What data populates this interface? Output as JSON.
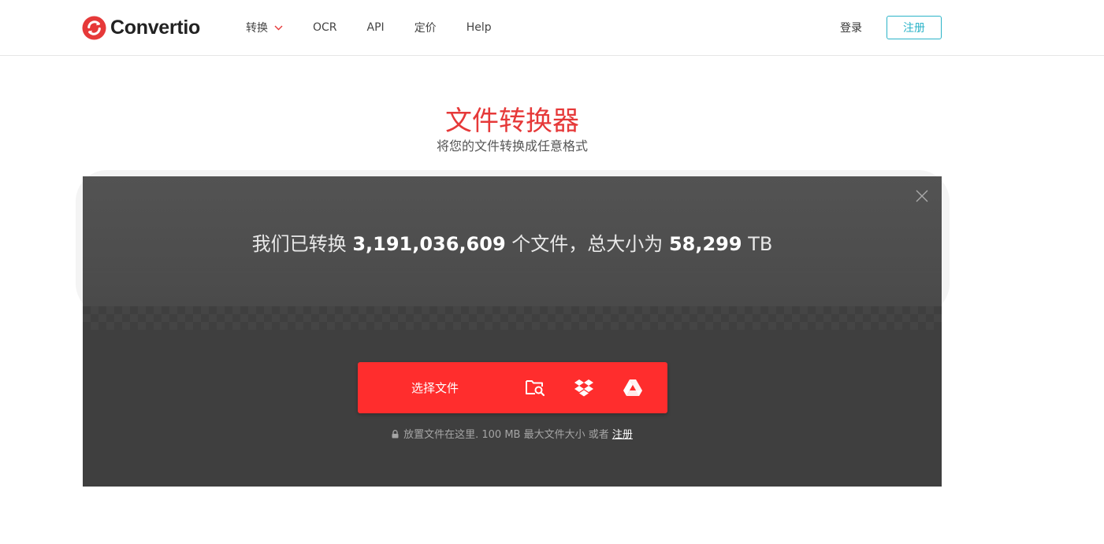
{
  "header": {
    "brand": "Convertio",
    "nav": [
      {
        "label": "转换",
        "has_dropdown": true
      },
      {
        "label": "OCR"
      },
      {
        "label": "API"
      },
      {
        "label": "定价"
      },
      {
        "label": "Help"
      }
    ],
    "login_label": "登录",
    "signup_label": "注册"
  },
  "hero": {
    "title": "文件转换器",
    "subtitle": "将您的文件转换成任意格式"
  },
  "stats": {
    "prefix": "我们已转换",
    "files_count": "3,191,036,609",
    "middle": "个文件，总大小为",
    "total_size": "58,299",
    "unit": "TB"
  },
  "upload": {
    "choose_label": "选择文件",
    "sources": [
      "computer-folder-icon",
      "dropbox-icon",
      "google-drive-icon"
    ],
    "note_text": "放置文件在这里. 100 MB 最大文件大小 或者",
    "note_link": "注册"
  },
  "colors": {
    "brand_red": "#e63939",
    "button_red": "#ff2d2d",
    "accent_teal": "#2bb3c8",
    "panel_dark": "#3f3f3f"
  }
}
